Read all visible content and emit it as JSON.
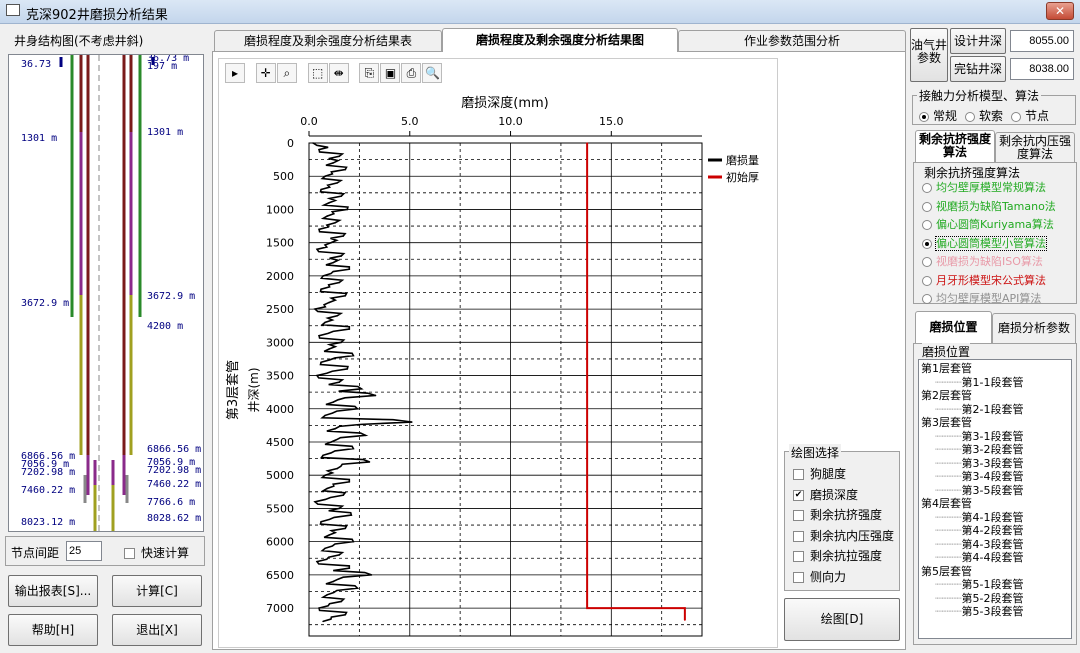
{
  "window": {
    "title": "克深902井磨损分析结果",
    "close": "✕"
  },
  "left": {
    "title": "井身结构图(不考虑井斜)",
    "labels_left": [
      "36.73",
      "1301 m",
      "3672.9 m",
      "6866.56 m",
      "7056.9 m",
      "7202.98 m",
      "7460.22 m",
      "8023.12 m"
    ],
    "labels_right": [
      "36.73 m",
      "197 m",
      "1301 m",
      "3672.9 m",
      "4200 m",
      "6866.56 m",
      "7056.9 m",
      "7202.98 m",
      "7460.22 m",
      "7766.6 m",
      "8028.62 m"
    ],
    "node_spacing_label": "节点间距",
    "node_spacing_value": "25",
    "fast_calc_label": "快速计算",
    "export_button": "输出报表[S]...",
    "calc_button": "计算[C]",
    "help_button": "帮助[H]",
    "exit_button": "退出[X]"
  },
  "tabs": [
    "磨损程度及剩余强度分析结果表",
    "磨损程度及剩余强度分析结果图",
    "作业参数范围分析"
  ],
  "plot_options": {
    "title": "绘图选择",
    "items": [
      {
        "label": "狗腿度",
        "checked": false
      },
      {
        "label": "磨损深度",
        "checked": true
      },
      {
        "label": "剩余抗挤强度",
        "checked": false
      },
      {
        "label": "剩余抗内压强度",
        "checked": false
      },
      {
        "label": "剩余抗拉强度",
        "checked": false
      },
      {
        "label": "侧向力",
        "checked": false
      }
    ],
    "draw_button": "绘图[D]"
  },
  "right": {
    "well_params_label": "油气井参数",
    "design_depth_label": "设计井深",
    "design_depth": "8055.00",
    "drilled_depth_label": "完钻井深",
    "drilled_depth": "8038.00",
    "model_group": "接触力分析模型、算法",
    "models": [
      {
        "label": "常规",
        "on": true
      },
      {
        "label": "软索",
        "on": false
      },
      {
        "label": "节点",
        "on": false
      }
    ],
    "strength_tabs": [
      "剩余抗挤强度算法",
      "剩余抗内压强度算法"
    ],
    "algo_group": "剩余抗挤强度算法",
    "algos": [
      {
        "label": "均匀壁厚模型常规算法",
        "color": "#22aa22",
        "on": false
      },
      {
        "label": "视磨损为缺陷Tamano法",
        "color": "#22aa22",
        "on": false
      },
      {
        "label": "偏心圆筒Kuriyama算法",
        "color": "#22aa22",
        "on": false
      },
      {
        "label": "偏心圆筒模型小管算法",
        "color": "#22aa22",
        "on": true
      },
      {
        "label": "视磨损为缺陷ISO算法",
        "color": "#e89aa8",
        "on": false
      },
      {
        "label": "月牙形模型宋公式算法",
        "color": "#cc1111",
        "on": false
      },
      {
        "label": "均匀壁厚模型API算法",
        "color": "#909090",
        "on": false
      }
    ],
    "pos_tabs": [
      "磨损位置",
      "磨损分析参数"
    ],
    "pos_group": "磨损位置",
    "tree": [
      {
        "label": "第1层套管",
        "children": [
          "第1-1段套管"
        ]
      },
      {
        "label": "第2层套管",
        "children": [
          "第2-1段套管"
        ]
      },
      {
        "label": "第3层套管",
        "children": [
          "第3-1段套管",
          "第3-2段套管",
          "第3-3段套管",
          "第3-4段套管",
          "第3-5段套管"
        ]
      },
      {
        "label": "第4层套管",
        "children": [
          "第4-1段套管",
          "第4-2段套管",
          "第4-3段套管",
          "第4-4段套管"
        ]
      },
      {
        "label": "第5层套管",
        "children": [
          "第5-1段套管",
          "第5-2段套管",
          "第5-3段套管"
        ]
      }
    ]
  },
  "chart_data": {
    "type": "line",
    "title": "磨损深度(mm)",
    "ylabel_group": "第3层套管",
    "ylabel": "井深(m)",
    "xlim": [
      0,
      19.5
    ],
    "ylim": [
      0,
      7420
    ],
    "xticks": [
      "0.0",
      "5.0",
      "10.0",
      "15.0"
    ],
    "xtick_values": [
      0,
      5,
      10,
      15
    ],
    "yticks": [
      "0",
      "500",
      "1000",
      "1500",
      "2000",
      "2500",
      "3000",
      "3500",
      "4000",
      "4500",
      "5000",
      "5500",
      "6000",
      "6500",
      "7000"
    ],
    "legend": [
      "磨损量",
      "初始厚"
    ],
    "series": [
      {
        "name": "磨损量",
        "color": "#000000",
        "depth": [
          0,
          100,
          200,
          300,
          400,
          500,
          600,
          700,
          800,
          900,
          1000,
          1100,
          1200,
          1300,
          1400,
          1500,
          1600,
          1700,
          1800,
          1900,
          2000,
          2100,
          2200,
          2300,
          2400,
          2500,
          2600,
          2700,
          2800,
          2900,
          3000,
          3100,
          3200,
          3300,
          3400,
          3500,
          3600,
          3700,
          3800,
          3900,
          4000,
          4100,
          4200,
          4300,
          4400,
          4500,
          4600,
          4700,
          4800,
          4900,
          5000,
          5100,
          5200,
          5300,
          5400,
          5500,
          5600,
          5700,
          5800,
          5900,
          6000,
          6100,
          6200,
          6300,
          6400,
          6500,
          6600,
          6700,
          6800,
          6900,
          7000,
          7100,
          7200
        ],
        "values": [
          0.2,
          0.5,
          1.5,
          1.2,
          1.8,
          0.8,
          1.4,
          0.6,
          1.6,
          1.0,
          1.9,
          0.9,
          1.3,
          0.5,
          1.7,
          1.1,
          0.4,
          1.6,
          1.2,
          2.0,
          0.7,
          1.5,
          0.6,
          1.8,
          1.0,
          0.3,
          1.4,
          0.8,
          2.0,
          0.5,
          1.6,
          1.0,
          2.2,
          0.6,
          1.9,
          0.4,
          1.5,
          2.6,
          3.3,
          1.2,
          2.4,
          0.8,
          5.1,
          1.3,
          2.8,
          1.1,
          2.2,
          0.7,
          3.0,
          1.4,
          0.8,
          2.0,
          0.9,
          1.7,
          0.3,
          1.5,
          2.1,
          0.6,
          1.8,
          1.0,
          2.2,
          0.8,
          1.5,
          0.4,
          2.0,
          3.1,
          1.2,
          2.4,
          0.9,
          1.6,
          0.5,
          1.8,
          0.7
        ]
      },
      {
        "name": "初始厚",
        "color": "#cc0000",
        "depth": [
          0,
          7000,
          7000,
          7180
        ],
        "values": [
          13.8,
          13.8,
          18.65,
          18.65
        ]
      }
    ]
  }
}
